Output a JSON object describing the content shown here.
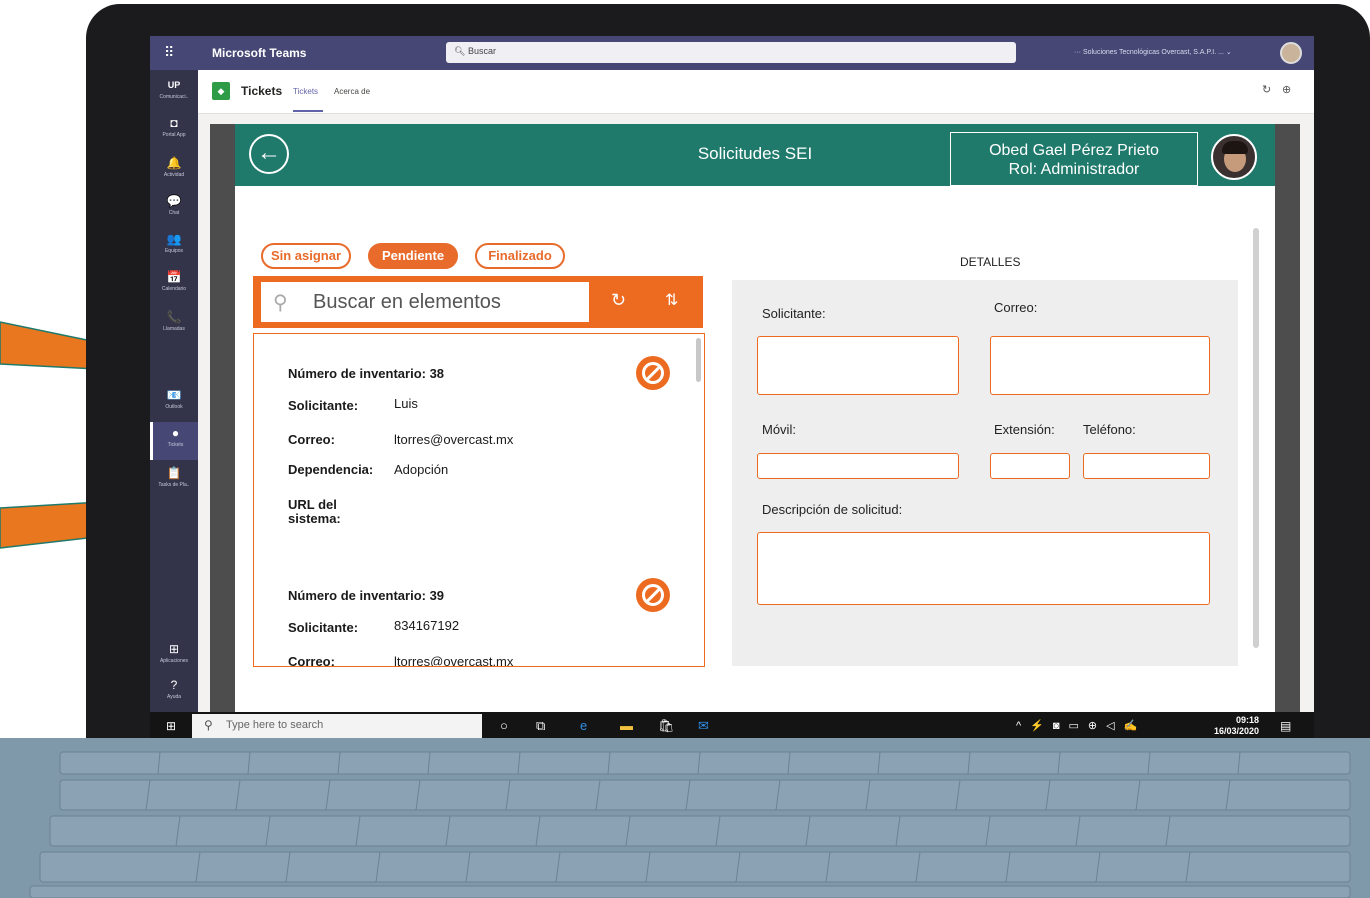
{
  "teams": {
    "app_name": "Microsoft Teams",
    "search_placeholder": "Buscar",
    "org": "···   Soluciones Tecnológicas Overcast, S.A.P.I. ...  ⌄",
    "rail": [
      {
        "label": "Comunicaci..",
        "icon": "UP"
      },
      {
        "label": "Portal App",
        "icon": "◘"
      },
      {
        "label": "Actividad",
        "icon": "🔔"
      },
      {
        "label": "Chat",
        "icon": "💬"
      },
      {
        "label": "Equipos",
        "icon": "👥"
      },
      {
        "label": "Calendario",
        "icon": "📅"
      },
      {
        "label": "Llamadas",
        "icon": "📞"
      },
      {
        "label": "Outlook",
        "icon": "📧"
      },
      {
        "label": "Tickets",
        "icon": "●"
      },
      {
        "label": "Tasks de Pla..",
        "icon": "📋"
      },
      {
        "label": "Aplicaciones",
        "icon": "⊞"
      },
      {
        "label": "Ayuda",
        "icon": "?"
      }
    ]
  },
  "app_header": {
    "name": "Tickets",
    "tabs": [
      "Tickets",
      "Acerca de"
    ]
  },
  "powerapp": {
    "title": "Solicitudes SEI",
    "user_name": "Obed Gael Pérez Prieto",
    "user_role": "Rol: Administrador",
    "filters": [
      "Sin asignar",
      "Pendiente",
      "Finalizado"
    ],
    "active_filter": "Pendiente",
    "search_placeholder": "Buscar en elementos",
    "records": [
      {
        "inventory_label": "Número de inventario: 38",
        "solicitante_label": "Solicitante:",
        "solicitante": "Luis",
        "correo_label": "Correo:",
        "correo": "ltorres@overcast.mx",
        "dependencia_label": "Dependencia:",
        "dependencia": "Adopción",
        "url_label": "URL del sistema:"
      },
      {
        "inventory_label": "Número de inventario: 39",
        "solicitante_label": "Solicitante:",
        "solicitante": "834167192",
        "correo_label": "Correo:",
        "correo": "ltorres@overcast.mx"
      }
    ],
    "details": {
      "title": "DETALLES",
      "solicitante": "Solicitante:",
      "correo": "Correo:",
      "movil": "Móvil:",
      "extension": "Extensión:",
      "telefono": "Teléfono:",
      "descripcion": "Descripción de solicitud:"
    },
    "accent_color": "#ed6a21",
    "header_color": "#1f7a6c"
  },
  "taskbar": {
    "search_placeholder": "Type here to search",
    "time": "09:18",
    "date": "16/03/2020"
  }
}
